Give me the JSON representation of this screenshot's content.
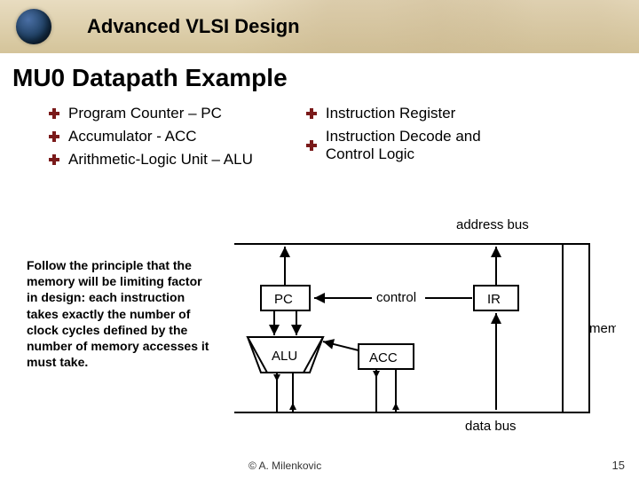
{
  "header": {
    "title": "Advanced VLSI Design"
  },
  "slide": {
    "title": "MU0 Datapath Example"
  },
  "bullets": {
    "left": [
      "Program Counter – PC",
      "Accumulator - ACC",
      "Arithmetic-Logic Unit – ALU"
    ],
    "right": [
      "Instruction Register",
      "Instruction Decode and Control Logic"
    ]
  },
  "principle": "Follow the principle that the memory will be limiting factor in design: each instruction takes exactly the number of clock cycles defined by the number of memory accesses it must take.",
  "diagram": {
    "top_bus": "address bus",
    "bottom_bus": "data bus",
    "pc": "PC",
    "alu": "ALU",
    "acc": "ACC",
    "control": "control",
    "ir": "IR",
    "memory": "memory"
  },
  "footer": {
    "copyright": "©  A. Milenkovic",
    "page": "15"
  }
}
